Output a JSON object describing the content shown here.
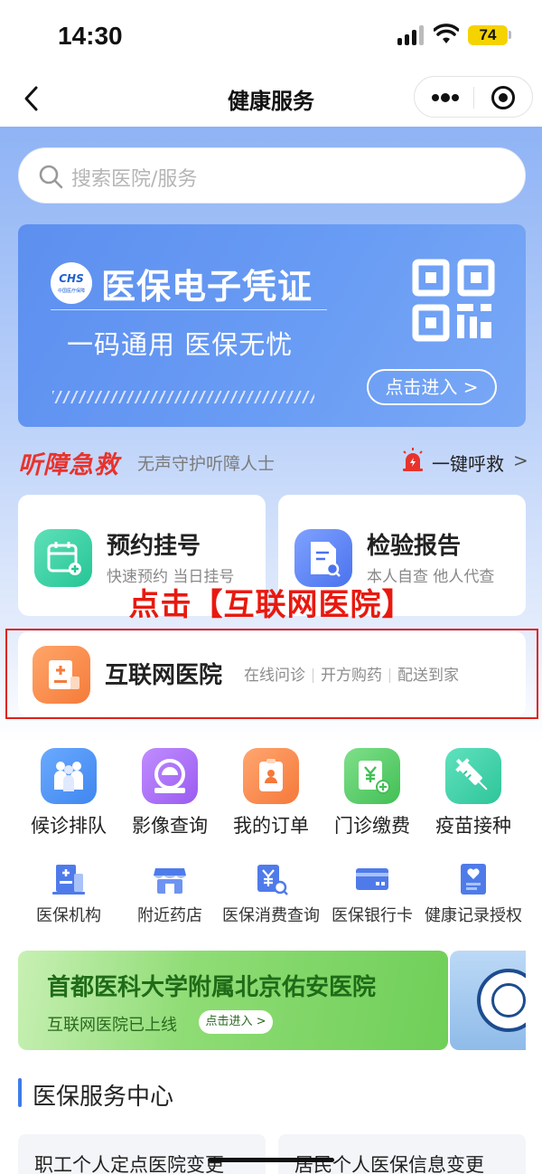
{
  "status_bar": {
    "time": "14:30",
    "battery": "74"
  },
  "nav": {
    "title": "健康服务"
  },
  "search": {
    "placeholder": "搜索医院/服务"
  },
  "banner": {
    "logo_abbr": "CHS",
    "logo_text": "中国医疗保障",
    "title": "医保电子凭证",
    "subtitle": "一码通用 医保无忧",
    "enter_label": "点击进入 >"
  },
  "hearing": {
    "title": "听障急救",
    "subtitle": "无声守护听障人士",
    "sos_label": "一键呼救",
    "chevron": ">"
  },
  "cards": [
    {
      "title": "预约挂号",
      "subtitle": "快速预约 当日挂号"
    },
    {
      "title": "检验报告",
      "subtitle": "本人自查 他人代查"
    }
  ],
  "annotation": "点击【互联网医院】",
  "internet_hospital": {
    "title": "互联网医院",
    "tags": [
      "在线问诊",
      "开方购药",
      "配送到家"
    ]
  },
  "grid_row1": [
    {
      "label": "候诊排队",
      "color": "#4a8ff0"
    },
    {
      "label": "影像查询",
      "color": "#a56ef0"
    },
    {
      "label": "我的订单",
      "color": "#f58a4c"
    },
    {
      "label": "门诊缴费",
      "color": "#5cc86a"
    },
    {
      "label": "疫苗接种",
      "color": "#3dcaa0"
    }
  ],
  "grid_row2": [
    {
      "label": "医保机构"
    },
    {
      "label": "附近药店"
    },
    {
      "label": "医保消费查询"
    },
    {
      "label": "医保银行卡"
    },
    {
      "label": "健康记录授权"
    }
  ],
  "promo": {
    "title": "首都医科大学附属北京佑安医院",
    "subtitle": "互联网医院已上线",
    "button": "点击进入 >"
  },
  "section": {
    "title": "医保服务中心"
  },
  "bottom_cards": [
    "职工个人定点医院变更",
    "居民个人医保信息变更"
  ]
}
